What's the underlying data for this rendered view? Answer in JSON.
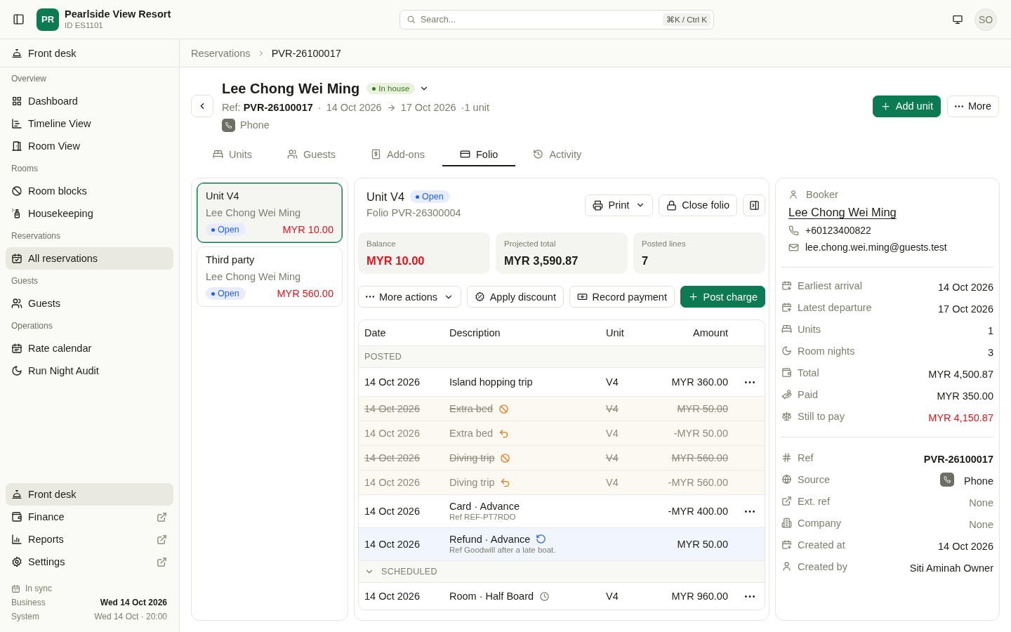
{
  "topbar": {
    "logo": "PR",
    "title": "Pearlside View Resort",
    "subtitle": "ID ES1101",
    "search": {
      "placeholder": "Search...",
      "shortcut": "⌘K / Ctrl K"
    },
    "avatar": "SO"
  },
  "sidebar": {
    "header": "Front desk",
    "groups": [
      {
        "title": "Overview",
        "items": [
          {
            "label": "Dashboard",
            "selected": false
          },
          {
            "label": "Timeline View",
            "selected": false
          },
          {
            "label": "Room View",
            "selected": false
          }
        ]
      },
      {
        "title": "Rooms",
        "items": [
          {
            "label": "Room blocks",
            "selected": false
          },
          {
            "label": "Housekeeping",
            "selected": false
          }
        ]
      },
      {
        "title": "Reservations",
        "items": [
          {
            "label": "All reservations",
            "selected": true
          }
        ]
      },
      {
        "title": "Guests",
        "items": [
          {
            "label": "Guests",
            "selected": false
          }
        ]
      },
      {
        "title": "Operations",
        "items": [
          {
            "label": "Rate calendar",
            "selected": false
          },
          {
            "label": "Run Night Audit",
            "selected": false
          }
        ]
      }
    ],
    "apps": [
      {
        "label": "Front desk",
        "selected": true,
        "external": false
      },
      {
        "label": "Finance",
        "selected": false,
        "external": true
      },
      {
        "label": "Reports",
        "selected": false,
        "external": true
      },
      {
        "label": "Settings",
        "selected": false,
        "external": true
      }
    ],
    "sync": {
      "status": "In sync",
      "rows": [
        {
          "label": "Business",
          "value": "Wed 14 Oct 2026",
          "kind": "strong"
        },
        {
          "label": "System",
          "value": "Wed 14 Oct · 20:00",
          "kind": "muted"
        }
      ]
    }
  },
  "breadcrumb": [
    {
      "label": "Reservations",
      "current": false
    },
    {
      "label": "PVR-26100017",
      "current": true
    }
  ],
  "reservation": {
    "guest": "Lee Chong Wei Ming",
    "status": "In house",
    "ref": "Ref: **PVR-26100017**",
    "separator": "·",
    "arrival": "14 Oct 2026",
    "departure": "17 Oct 2026",
    "units": "·1 unit",
    "source": "Phone",
    "actions": [
      {
        "label": "Add unit",
        "kind": "primary"
      },
      {
        "label": "More",
        "kind": "secondary"
      }
    ]
  },
  "tabs": [
    {
      "label": "Units",
      "selected": false
    },
    {
      "label": "Guests",
      "selected": false
    },
    {
      "label": "Add-ons",
      "selected": false
    },
    {
      "label": "Folio",
      "selected": true
    },
    {
      "label": "Activity",
      "selected": false
    }
  ],
  "folios": [
    {
      "title": "Unit V4",
      "guest": "Lee Chong Wei Ming",
      "status": "Open",
      "amount": "MYR 10.00",
      "selected": true
    },
    {
      "title": "Third party",
      "guest": "Lee Chong Wei Ming",
      "status": "Open",
      "amount": "MYR 560.00",
      "selected": false
    }
  ],
  "folio": {
    "title": "Unit V4",
    "status": "Open",
    "number": "Folio PVR-26300004",
    "tools": [
      {
        "label": "Print",
        "dropdown": true
      },
      {
        "label": "Close folio",
        "dropdown": false
      }
    ],
    "stats": [
      {
        "label": "Balance",
        "value": "MYR 10.00",
        "kind": "danger"
      },
      {
        "label": "Projected total",
        "value": "MYR 3,590.87",
        "kind": "plain"
      },
      {
        "label": "Posted lines",
        "value": "7",
        "kind": "plain"
      }
    ],
    "actions": [
      {
        "label": "More actions",
        "kind": "menu"
      },
      {
        "label": "Apply discount",
        "kind": "secondary"
      },
      {
        "label": "Record payment",
        "kind": "secondary"
      },
      {
        "label": "Post charge",
        "kind": "primary"
      }
    ],
    "table": {
      "columns": [
        "Date",
        "Description",
        "Unit",
        "Amount"
      ],
      "sections": [
        {
          "title": "POSTED",
          "collapsible": false,
          "expanded": true,
          "rows": [
            {
              "date": "14 Oct 2026",
              "description": "Island hopping trip",
              "unit": "V4",
              "amount": "MYR 360.00",
              "kind": "charge",
              "menu": true
            },
            {
              "date": "14 Oct 2026",
              "description": "Extra bed",
              "unit": "V4",
              "amount": "MYR 50.00",
              "kind": "void",
              "menu": false
            },
            {
              "date": "14 Oct 2026",
              "description": "Extra bed",
              "unit": "V4",
              "amount": "-MYR 50.00",
              "kind": "reversal",
              "menu": false
            },
            {
              "date": "14 Oct 2026",
              "description": "Diving trip",
              "unit": "V4",
              "amount": "MYR 560.00",
              "kind": "void",
              "menu": false
            },
            {
              "date": "14 Oct 2026",
              "description": "Diving trip",
              "unit": "V4",
              "amount": "-MYR 560.00",
              "kind": "reversal",
              "menu": false
            },
            {
              "date": "14 Oct 2026",
              "description": "Card · Advance",
              "note": "Ref REF-PT7RDO",
              "amount": "-MYR 400.00",
              "kind": "payment",
              "menu": true
            },
            {
              "date": "14 Oct 2026",
              "description": "Refund · Advance",
              "note": "Ref Goodwill after a late boat.",
              "amount": "MYR 50.00",
              "kind": "refund",
              "menu": false
            }
          ]
        },
        {
          "title": "SCHEDULED",
          "collapsible": true,
          "expanded": true,
          "rows": [
            {
              "date": "14 Oct 2026",
              "description": "Room · Half Board",
              "unit": "V4",
              "amount": "MYR 960.00",
              "kind": "scheduled",
              "menu": true
            }
          ]
        }
      ]
    }
  },
  "booker": {
    "label": "Booker",
    "name": "Lee Chong Wei Ming",
    "phone": "+60123400822",
    "email": "lee.chong.wei.ming@guests.test"
  },
  "summary": [
    {
      "label": "Earliest arrival",
      "value": "14 Oct 2026",
      "kind": "plain"
    },
    {
      "label": "Latest departure",
      "value": "17 Oct 2026",
      "kind": "plain"
    },
    {
      "label": "Units",
      "value": "1",
      "kind": "plain"
    },
    {
      "label": "Room nights",
      "value": "3",
      "kind": "plain"
    },
    {
      "label": "Total",
      "value": "MYR 4,500.87",
      "kind": "plain"
    },
    {
      "label": "Paid",
      "value": "MYR 350.00",
      "kind": "plain"
    },
    {
      "label": "Still to pay",
      "value": "MYR 4,150.87",
      "kind": "danger"
    }
  ],
  "details": [
    {
      "label": "Ref",
      "value": "PVR-26100017",
      "kind": "strong"
    },
    {
      "label": "Source",
      "value": "Phone",
      "kind": "source"
    },
    {
      "label": "Ext. ref",
      "value": "None",
      "kind": "muted"
    },
    {
      "label": "Company",
      "value": "None",
      "kind": "muted"
    },
    {
      "label": "Created at",
      "value": "14 Oct 2026",
      "kind": "plain"
    },
    {
      "label": "Created by",
      "value": "Siti Aminah Owner",
      "kind": "plain"
    }
  ]
}
